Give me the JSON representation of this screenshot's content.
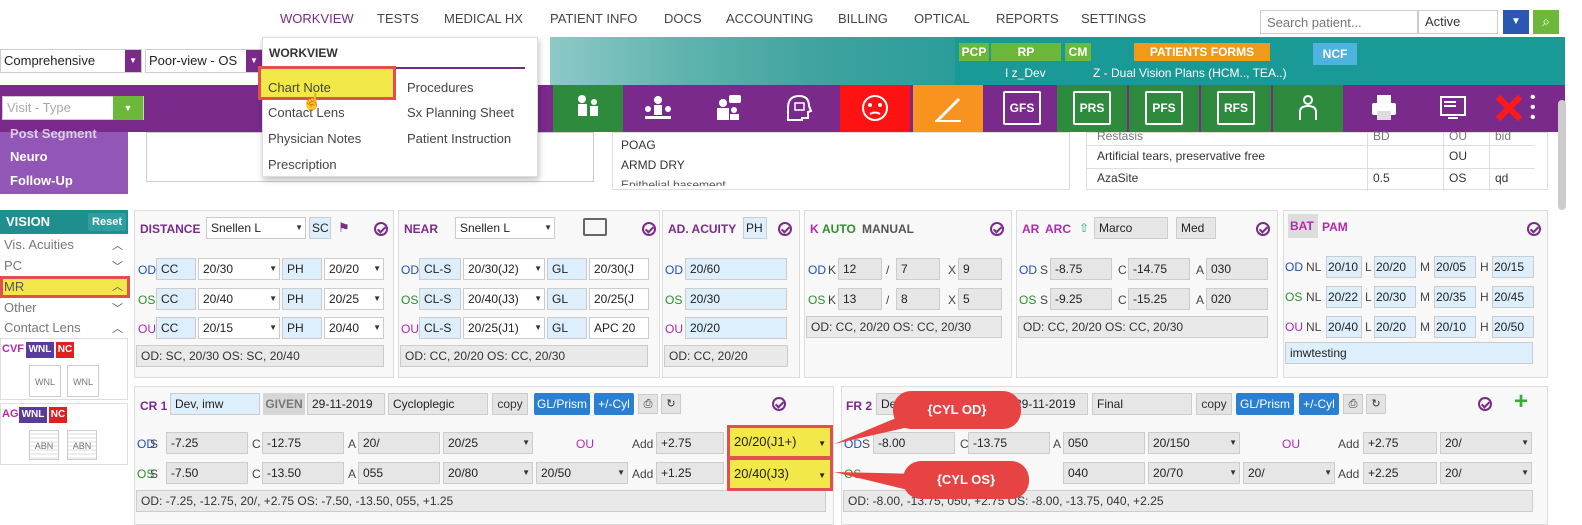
{
  "nav": {
    "items": [
      "WORKVIEW",
      "TESTS",
      "MEDICAL HX",
      "PATIENT INFO",
      "DOCS",
      "ACCOUNTING",
      "BILLING",
      "OPTICAL",
      "REPORTS",
      "SETTINGS"
    ],
    "search_placeholder": "Search patient...",
    "status_value": "Active"
  },
  "template": {
    "exam_type": "Comprehensive",
    "view": "Poor-view - OS",
    "visit_type_placeholder": "Visit - Type"
  },
  "header": {
    "tags": [
      "PCP",
      "RP",
      "CM"
    ],
    "patients_forms": "PATIENTS FORMS",
    "ncf": "NCF",
    "rp_value": "I z_Dev",
    "cm_value": "Z - Dual Vision Plans (HCM.., TEA..)"
  },
  "toolbar": {
    "text_buttons": [
      "GFS",
      "PRS",
      "PFS",
      "RFS"
    ]
  },
  "dropdown": {
    "title": "WORKVIEW",
    "col1": [
      "Chart Note",
      "Contact Lens",
      "Physician Notes",
      "Prescription"
    ],
    "col2": [
      "Procedures",
      "Sx Planning Sheet",
      "Patient Instruction"
    ]
  },
  "left": {
    "purple_items": [
      "Post Segment",
      "Neuro",
      "Follow-Up"
    ],
    "vision_title": "VISION",
    "reset": "Reset",
    "items": [
      "Vis. Acuities",
      "PC",
      "MR",
      "Other",
      "Contact Lens"
    ],
    "cvf": "CVF",
    "ag": "AG",
    "wnl": "WNL",
    "nc": "NC",
    "abn": "ABN"
  },
  "assessment": {
    "items": [
      "POAG",
      "ARMD DRY",
      "Epithelial basement"
    ]
  },
  "meds": {
    "rows": [
      {
        "name": "Restasis",
        "dose": "BD",
        "eye": "OU",
        "freq": "bid"
      },
      {
        "name": "Artificial tears, preservative free",
        "dose": "",
        "eye": "OU",
        "freq": ""
      },
      {
        "name": "AzaSite",
        "dose": "0.5",
        "eye": "OS",
        "freq": "qd"
      }
    ]
  },
  "distance": {
    "title": "DISTANCE",
    "chart": "Snellen L",
    "sc": "SC",
    "rows": [
      {
        "eye": "OD",
        "c": "CC",
        "v1": "20/30",
        "ph": "PH",
        "v2": "20/20"
      },
      {
        "eye": "OS",
        "c": "CC",
        "v1": "20/40",
        "ph": "PH",
        "v2": "20/25"
      },
      {
        "eye": "OU",
        "c": "CC",
        "v1": "20/15",
        "ph": "PH",
        "v2": "20/40"
      }
    ],
    "summary": "OD: SC, 20/30 OS: SC, 20/40"
  },
  "near": {
    "title": "NEAR",
    "chart": "Snellen L",
    "rows": [
      {
        "eye": "OD",
        "c": "CL-S",
        "v1": "20/30(J2)",
        "g": "GL",
        "v2": "20/30(J"
      },
      {
        "eye": "OS",
        "c": "CL-S",
        "v1": "20/40(J3)",
        "g": "GL",
        "v2": "20/25(J"
      },
      {
        "eye": "OU",
        "c": "CL-S",
        "v1": "20/25(J1)",
        "g": "GL",
        "v2": "APC 20"
      }
    ],
    "summary": "OD: CC, 20/20 OS: CC, 20/30"
  },
  "ad_acuity": {
    "title": "AD. ACUITY",
    "ph": "PH",
    "rows": [
      {
        "eye": "OD",
        "v": "20/60"
      },
      {
        "eye": "OS",
        "v": "20/30"
      },
      {
        "eye": "OU",
        "v": "20/20"
      }
    ],
    "summary": "OD: CC, 20/20"
  },
  "k": {
    "k": "K",
    "auto": "AUTO",
    "manual": "MANUAL",
    "rows": [
      {
        "eye": "OD",
        "k": "12",
        "s": "7",
        "x": "9"
      },
      {
        "eye": "OS",
        "k": "13",
        "s": "8",
        "x": "5"
      }
    ],
    "summary": "OD: CC, 20/20 OS: CC, 20/30"
  },
  "ar": {
    "ar": "AR",
    "arc": "ARC",
    "name": "Marco",
    "med": "Med",
    "rows": [
      {
        "eye": "OD",
        "s": "-8.75",
        "c": "-14.75",
        "a": "030"
      },
      {
        "eye": "OS",
        "s": "-9.25",
        "c": "-15.25",
        "a": "020"
      }
    ],
    "summary": "OD: CC, 20/20 OS: CC, 20/30"
  },
  "bat": {
    "bat": "BAT",
    "pam": "PAM",
    "rows": [
      {
        "eye": "OD",
        "nl": "20/10",
        "l": "20/20",
        "m": "20/05",
        "h": "20/15"
      },
      {
        "eye": "OS",
        "nl": "20/22",
        "l": "20/30",
        "m": "20/35",
        "h": "20/45"
      },
      {
        "eye": "OU",
        "nl": "20/40",
        "l": "20/20",
        "m": "20/10",
        "h": "20/50"
      }
    ],
    "note": "imwtesting"
  },
  "cr": {
    "title": "CR 1",
    "provider": "Dev, imw",
    "given": "GIVEN",
    "date": "29-11-2019",
    "type": "Cycloplegic",
    "copy": "copy",
    "gl_prism": "GL/Prism",
    "cyl": "+/-Cyl",
    "od": {
      "s": "-7.25",
      "c": "-12.75",
      "a": "20/",
      "v": "20/25",
      "add": "+2.75",
      "dva": "20/20(J1+)"
    },
    "os": {
      "s": "-7.50",
      "c": "-13.50",
      "a": "055",
      "v": "20/80",
      "v2": "20/50",
      "add": "+1.25",
      "dva": "20/40(J3)"
    },
    "ou": "OU",
    "summary": "OD: -7.25, -12.75, 20/, +2.75 OS: -7.50, -13.50, 055, +1.25"
  },
  "fr": {
    "title": "FR 2",
    "provider": "Dev",
    "date": "29-11-2019",
    "type": "Final",
    "copy": "copy",
    "gl_prism": "GL/Prism",
    "cyl": "+/-Cyl",
    "od": {
      "s": "-8.00",
      "c": "-13.75",
      "a": "050",
      "v": "20/150",
      "add": "+2.75",
      "dva": "20/"
    },
    "os": {
      "a": "040",
      "v": "20/70",
      "v2": "20/",
      "add": "+2.25",
      "dva": "20/"
    },
    "ou": "OU",
    "summary": "OD: -8.00, -13.75, 050, +2.75 OS: -8.00, -13.75, 040, +2.25"
  },
  "callouts": {
    "od": "{CYL OD}",
    "os": "{CYL OS}"
  },
  "labels": {
    "s": "S",
    "c": "C",
    "a": "A",
    "k": "K",
    "x": "X",
    "add": "Add",
    "nl": "NL",
    "l": "L",
    "m": "M",
    "h": "H",
    "slash": "/"
  },
  "colors": {
    "purple": "#7a2a8a",
    "teal": "#1a9a96",
    "green": "#6bb83a",
    "highlight": "#f3e84a",
    "red": "#e05050"
  }
}
